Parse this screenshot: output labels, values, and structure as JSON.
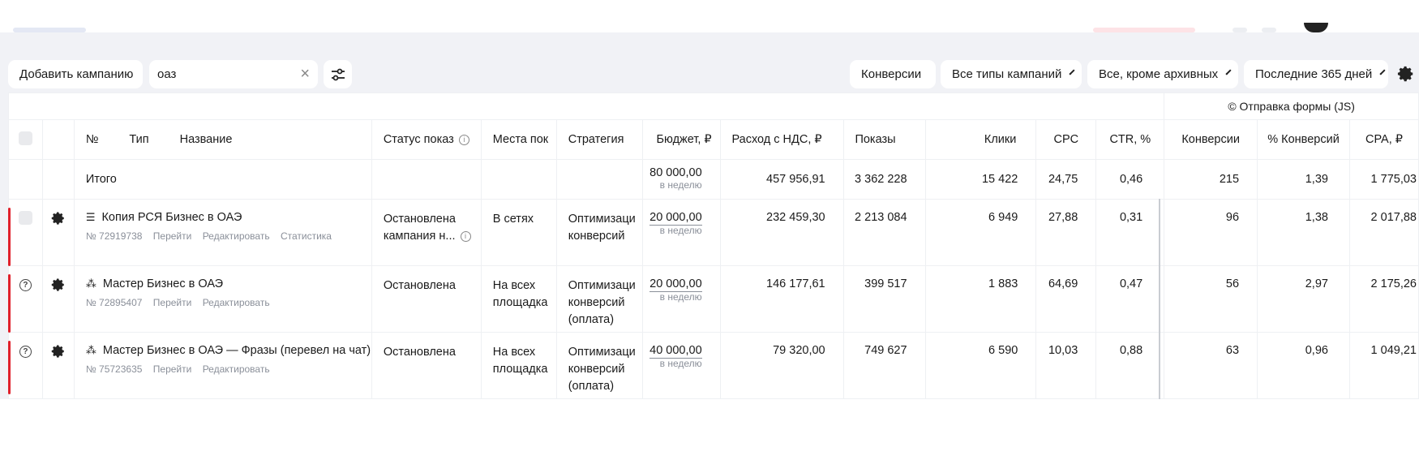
{
  "toolbar": {
    "add_campaign": "Добавить кампанию",
    "search_value": "оаз",
    "conversions": "Конверсии",
    "campaign_types": "Все типы кампаний",
    "archive_filter": "Все, кроме архивных",
    "period": "Последние 365 дней"
  },
  "table": {
    "goal_label": "© Отправка формы (JS)",
    "columns": {
      "no": "№",
      "type": "Тип",
      "name": "Название",
      "status": "Статус показ",
      "places": "Места пок",
      "strategy": "Стратегия",
      "budget": "Бюджет, ₽",
      "spend": "Расход с НДС, ₽",
      "impressions": "Показы",
      "clicks": "Клики",
      "cpc": "CPC",
      "ctr": "CTR, %",
      "conversions": "Конверсии",
      "conv_rate": "% Конверсий",
      "cpa": "CPA, ₽"
    },
    "total": {
      "label": "Итого",
      "budget": "80 000,00",
      "budget_period": "в неделю",
      "spend": "457 956,91",
      "impressions": "3 362 228",
      "clicks": "15 422",
      "cpc": "24,75",
      "ctr": "0,46",
      "conversions": "215",
      "conv_rate": "1,39",
      "cpa": "1 775,03"
    },
    "rows": [
      {
        "name": "Копия РСЯ Бизнес в ОАЭ",
        "number": "№ 72919738",
        "link_go": "Перейти",
        "link_edit": "Редактировать",
        "link_stats": "Статистика",
        "status": "Остановлена кампания н...",
        "places": "В сетях",
        "strategy": "Оптимизаци конверсий",
        "budget": "20 000,00",
        "budget_period": "в неделю",
        "spend": "232 459,30",
        "impressions": "2 213 084",
        "clicks": "6 949",
        "cpc": "27,88",
        "ctr": "0,31",
        "conversions": "96",
        "conv_rate": "1,38",
        "cpa": "2 017,88"
      },
      {
        "name": "Мастер Бизнес в ОАЭ",
        "number": "№ 72895407",
        "link_go": "Перейти",
        "link_edit": "Редактировать",
        "status": "Остановлена",
        "places": "На всех площадка",
        "strategy": "Оптимизаци конверсий (оплата)",
        "budget": "20 000,00",
        "budget_period": "в неделю",
        "spend": "146 177,61",
        "impressions": "399 517",
        "clicks": "1 883",
        "cpc": "64,69",
        "ctr": "0,47",
        "conversions": "56",
        "conv_rate": "2,97",
        "cpa": "2 175,26"
      },
      {
        "name": "Мастер Бизнес в ОАЭ — Фразы (перевел на чат)",
        "number": "№ 75723635",
        "link_go": "Перейти",
        "link_edit": "Редактировать",
        "status": "Остановлена",
        "places": "На всех площадка",
        "strategy": "Оптимизаци конверсий (оплата)",
        "budget": "40 000,00",
        "budget_period": "в неделю",
        "spend": "79 320,00",
        "impressions": "749 627",
        "clicks": "6 590",
        "cpc": "10,03",
        "ctr": "0,88",
        "conversions": "63",
        "conv_rate": "0,96",
        "cpa": "1 049,21"
      }
    ]
  },
  "colors": {
    "accent_red": "#e0202b",
    "workspace_bg": "#f1f2f6"
  },
  "icons": [
    "clear-icon",
    "filter-sliders-icon",
    "settings-gear-icon",
    "chevron-down-icon",
    "help-circle-icon",
    "info-icon",
    "network-type-icon",
    "master-type-icon"
  ]
}
